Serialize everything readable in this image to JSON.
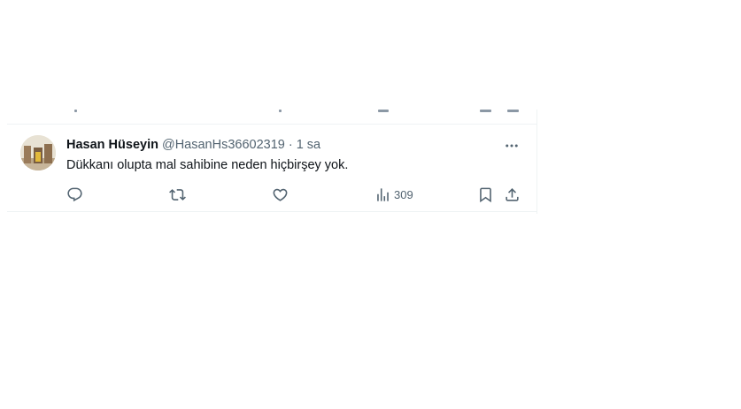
{
  "tweet": {
    "author_name": "Hasan Hüseyin",
    "author_handle": "@HasanHs36602319",
    "separator": "·",
    "time_ago": "1 sa",
    "text": "Dükkanı olupta mal sahibine neden hiçbirşey yok.",
    "actions": {
      "reply": {
        "icon": "reply-icon",
        "count": ""
      },
      "retweet": {
        "icon": "retweet-icon",
        "count": ""
      },
      "like": {
        "icon": "heart-icon",
        "count": ""
      },
      "views": {
        "icon": "views-icon",
        "count": "309"
      },
      "bookmark": {
        "icon": "bookmark-icon"
      },
      "share": {
        "icon": "share-icon"
      }
    },
    "more_icon": "more-horizontal-icon"
  },
  "colors": {
    "text_primary": "#0f1419",
    "text_secondary": "#536471",
    "border": "#eff3f4",
    "background": "#ffffff"
  }
}
